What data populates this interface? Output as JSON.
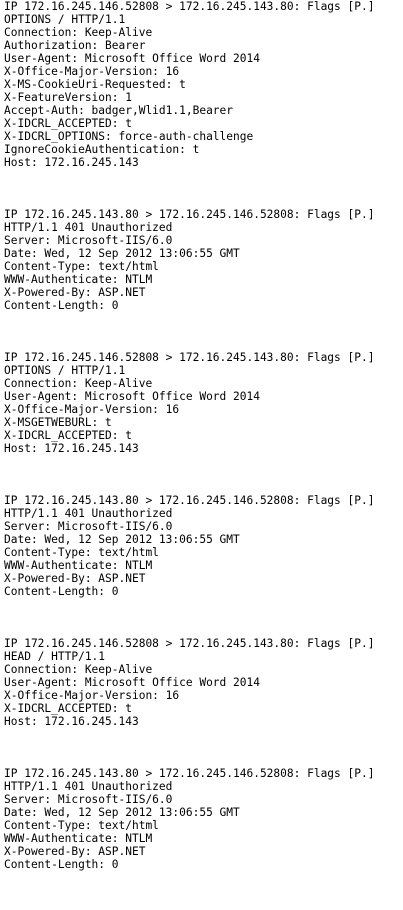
{
  "packets": [
    {
      "lines": [
        "IP 172.16.245.146.52808 > 172.16.245.143.80: Flags [P.]",
        "OPTIONS / HTTP/1.1",
        "Connection: Keep-Alive",
        "Authorization: Bearer",
        "User-Agent: Microsoft Office Word 2014",
        "X-Office-Major-Version: 16",
        "X-MS-CookieUri-Requested: t",
        "X-FeatureVersion: 1",
        "Accept-Auth: badger,Wlid1.1,Bearer",
        "X-IDCRL_ACCEPTED: t",
        "X-IDCRL_OPTIONS: force-auth-challenge",
        "IgnoreCookieAuthentication: t",
        "Host: 172.16.245.143"
      ]
    },
    {
      "lines": [
        "IP 172.16.245.143.80 > 172.16.245.146.52808: Flags [P.]",
        "HTTP/1.1 401 Unauthorized",
        "Server: Microsoft-IIS/6.0",
        "Date: Wed, 12 Sep 2012 13:06:55 GMT",
        "Content-Type: text/html",
        "WWW-Authenticate: NTLM",
        "X-Powered-By: ASP.NET",
        "Content-Length: 0"
      ]
    },
    {
      "lines": [
        "IP 172.16.245.146.52808 > 172.16.245.143.80: Flags [P.]",
        "OPTIONS / HTTP/1.1",
        "Connection: Keep-Alive",
        "User-Agent: Microsoft Office Word 2014",
        "X-Office-Major-Version: 16",
        "X-MSGETWEBURL: t",
        "X-IDCRL_ACCEPTED: t",
        "Host: 172.16.245.143"
      ]
    },
    {
      "lines": [
        "IP 172.16.245.143.80 > 172.16.245.146.52808: Flags [P.]",
        "HTTP/1.1 401 Unauthorized",
        "Server: Microsoft-IIS/6.0",
        "Date: Wed, 12 Sep 2012 13:06:55 GMT",
        "Content-Type: text/html",
        "WWW-Authenticate: NTLM",
        "X-Powered-By: ASP.NET",
        "Content-Length: 0"
      ]
    },
    {
      "lines": [
        "IP 172.16.245.146.52808 > 172.16.245.143.80: Flags [P.]",
        "HEAD / HTTP/1.1",
        "Connection: Keep-Alive",
        "User-Agent: Microsoft Office Word 2014",
        "X-Office-Major-Version: 16",
        "X-IDCRL_ACCEPTED: t",
        "Host: 172.16.245.143"
      ]
    },
    {
      "lines": [
        "IP 172.16.245.143.80 > 172.16.245.146.52808: Flags [P.]",
        "HTTP/1.1 401 Unauthorized",
        "Server: Microsoft-IIS/6.0",
        "Date: Wed, 12 Sep 2012 13:06:55 GMT",
        "Content-Type: text/html",
        "WWW-Authenticate: NTLM",
        "X-Powered-By: ASP.NET",
        "Content-Length: 0"
      ]
    }
  ]
}
